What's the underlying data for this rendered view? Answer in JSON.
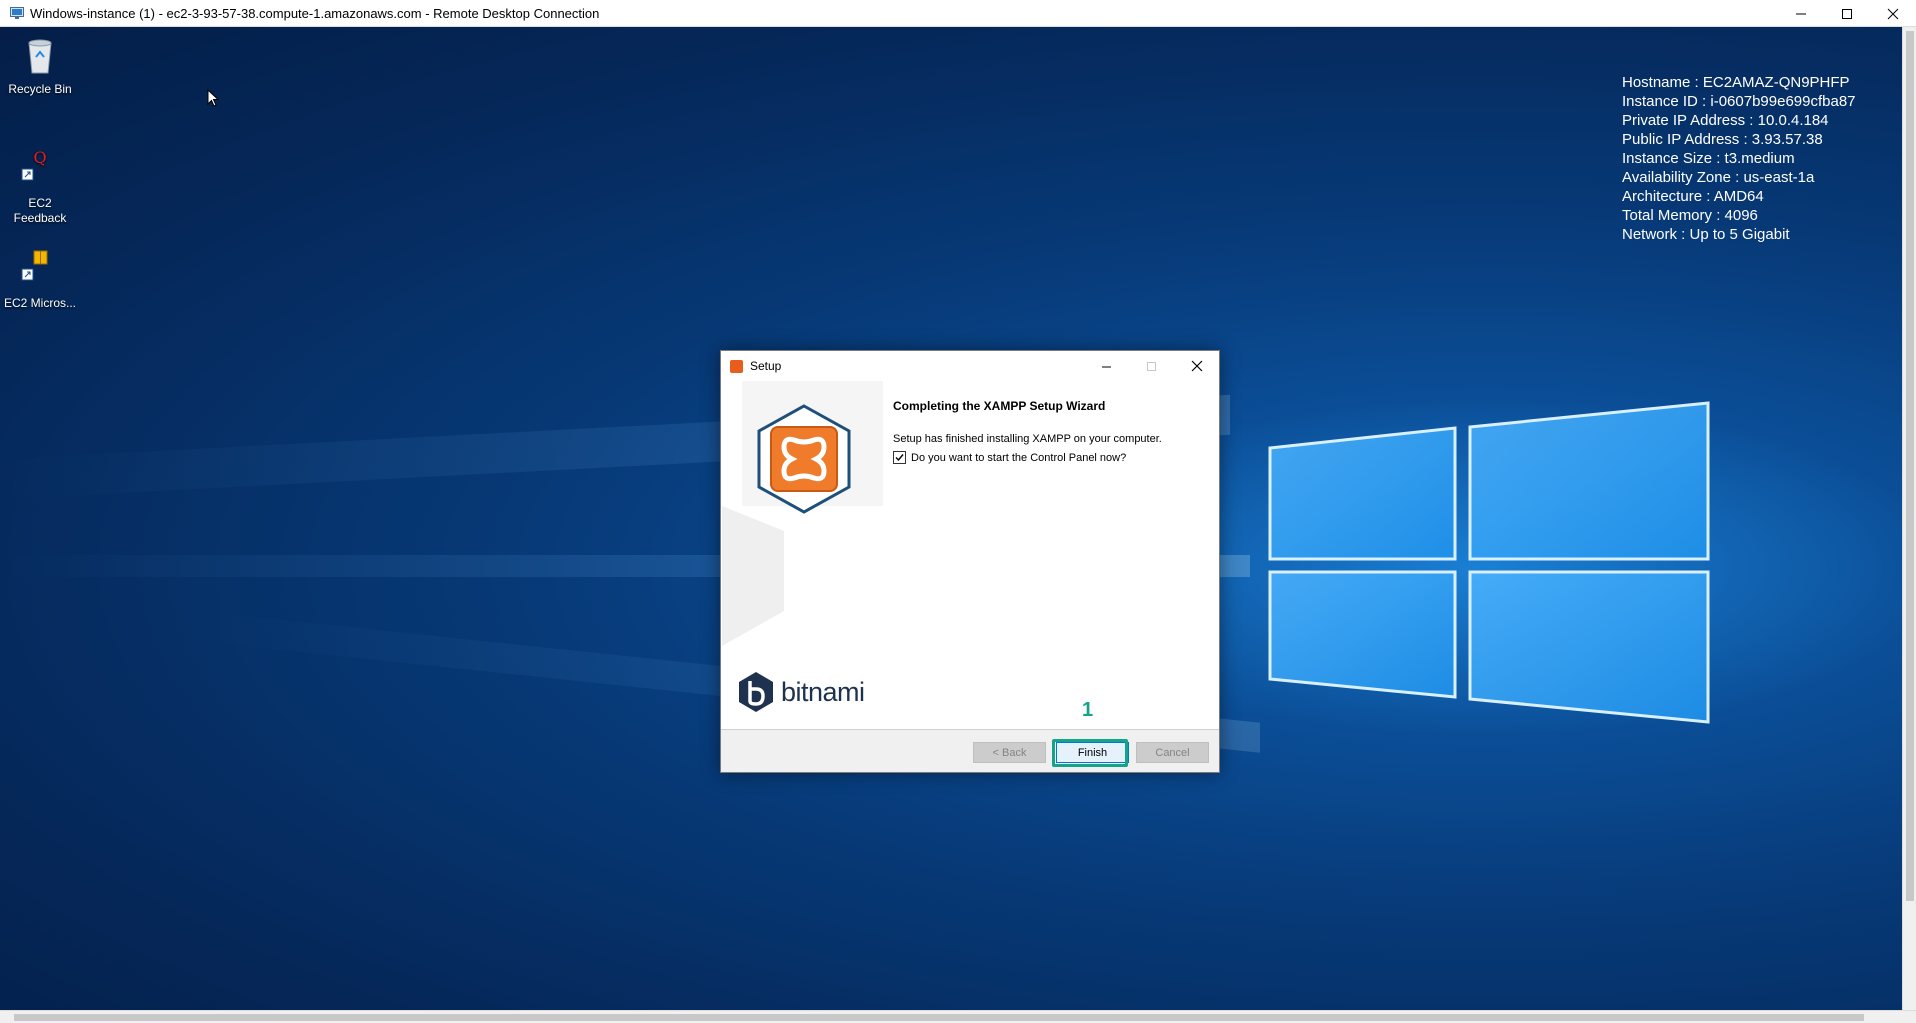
{
  "rdp": {
    "title": "Windows-instance (1) - ec2-3-93-57-38.compute-1.amazonaws.com - Remote Desktop Connection"
  },
  "desktop": {
    "icons": [
      {
        "label": "Recycle Bin"
      },
      {
        "label": "EC2 Feedback"
      },
      {
        "label": "EC2 Micros..."
      }
    ],
    "info_lines": [
      "Hostname : EC2AMAZ-QN9PHFP",
      "Instance ID : i-0607b99e699cfba87",
      "Private IP Address : 10.0.4.184",
      "Public IP Address : 3.93.57.38",
      "Instance Size : t3.medium",
      "Availability Zone : us-east-1a",
      "Architecture : AMD64",
      "Total Memory : 4096",
      "Network : Up to 5 Gigabit"
    ]
  },
  "dialog": {
    "title": "Setup",
    "heading": "Completing the XAMPP Setup Wizard",
    "message": "Setup has finished installing XAMPP on your computer.",
    "checkbox_label": "Do you want to start the Control Panel now?",
    "checkbox_checked": true,
    "brand": "bitnami",
    "buttons": {
      "back": "< Back",
      "finish": "Finish",
      "cancel": "Cancel"
    }
  },
  "annotation": {
    "step_number": "1",
    "color": "#14a38b"
  }
}
